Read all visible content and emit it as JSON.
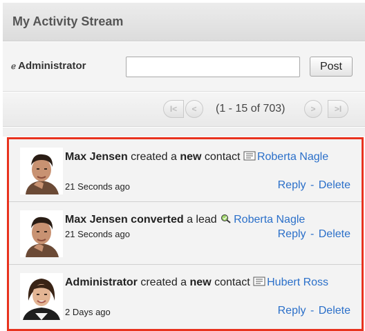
{
  "header": {
    "title": "My Activity Stream"
  },
  "post": {
    "user_label": "Administrator",
    "input_value": "",
    "button_label": "Post"
  },
  "pager": {
    "text": "(1 - 15 of 703)",
    "start_label": "I<",
    "prev_label": "<",
    "next_label": ">",
    "end_label": ">I"
  },
  "entries": [
    {
      "actor": "Max Jensen",
      "verb": " created a ",
      "adj": "new",
      "obj": " contact ",
      "target": "Roberta Nagle",
      "time": "21 Seconds ago",
      "reply": "Reply",
      "sep": "-",
      "delete": "Delete",
      "icon": "contact-card-icon"
    },
    {
      "actor": "Max Jensen",
      "verb_bold": " converted",
      "obj": " a lead ",
      "target": "Roberta Nagle",
      "time": "21 Seconds ago",
      "reply": "Reply",
      "sep": "-",
      "delete": "Delete",
      "icon": "lead-convert-icon"
    },
    {
      "actor": "Administrator",
      "verb": " created a ",
      "adj": "new",
      "obj": " contact ",
      "target": "Hubert Ross",
      "time": "2 Days ago",
      "reply": "Reply",
      "sep": "-",
      "delete": "Delete",
      "icon": "contact-card-icon"
    }
  ],
  "colors": {
    "link": "#2a6fc9",
    "highlight_border": "#e8321e"
  }
}
